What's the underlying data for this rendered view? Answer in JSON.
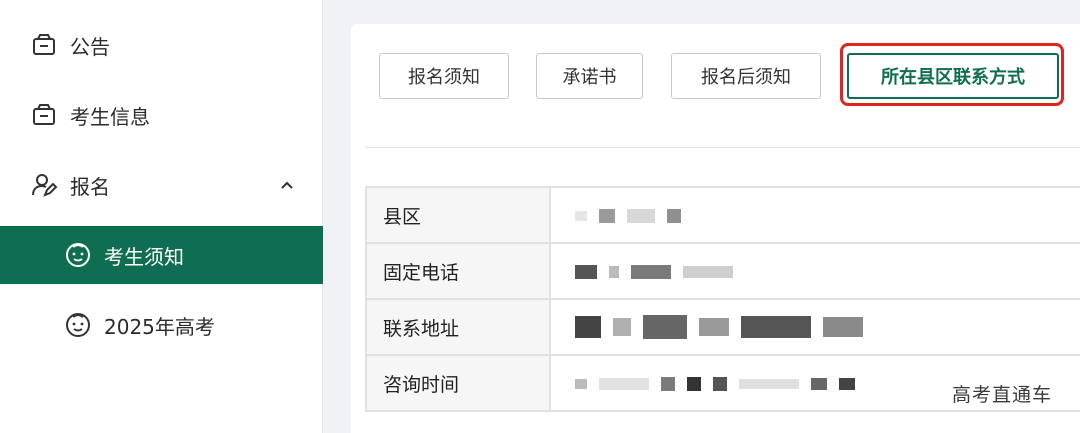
{
  "sidebar": {
    "items": [
      {
        "label": "公告",
        "icon": "box-icon"
      },
      {
        "label": "考生信息",
        "icon": "box-icon"
      },
      {
        "label": "报名",
        "icon": "user-edit-icon",
        "expanded": true
      },
      {
        "label": "考生须知",
        "icon": "smile-icon",
        "active": true
      },
      {
        "label": "2025年高考",
        "icon": "smile-icon"
      }
    ]
  },
  "tabs": [
    {
      "label": "报名须知"
    },
    {
      "label": "承诺书"
    },
    {
      "label": "报名后须知"
    },
    {
      "label": "所在县区联系方式",
      "selected": true
    }
  ],
  "table": {
    "rows": [
      {
        "label": "县区",
        "value": ""
      },
      {
        "label": "固定电话",
        "value": ""
      },
      {
        "label": "联系地址",
        "value": ""
      },
      {
        "label": "咨询时间",
        "value": ""
      }
    ]
  },
  "watermark": "高考直通车",
  "colors": {
    "accent": "#0f6e52",
    "highlight": "#e0251f"
  }
}
